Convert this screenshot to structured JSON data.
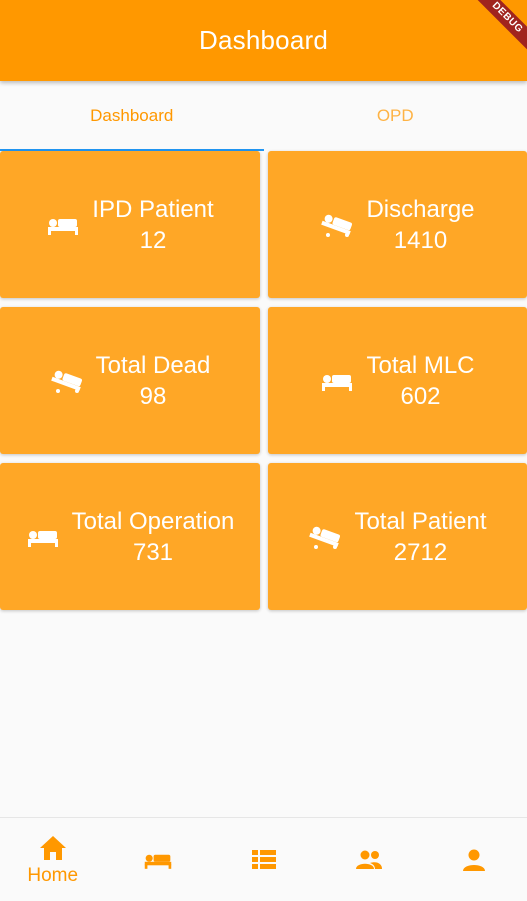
{
  "app": {
    "title": "Dashboard",
    "debug_banner": "DEBUG"
  },
  "tabs": [
    {
      "label": "Dashboard",
      "active": true
    },
    {
      "label": "OPD",
      "active": false
    }
  ],
  "cards": [
    {
      "title": "IPD Patient",
      "value": "12",
      "icon": "hospital-bed-icon"
    },
    {
      "title": "Discharge",
      "value": "1410",
      "icon": "patient-transfer-icon"
    },
    {
      "title": "Total Dead",
      "value": "98",
      "icon": "patient-transfer-icon"
    },
    {
      "title": "Total MLC",
      "value": "602",
      "icon": "hospital-bed-icon"
    },
    {
      "title": "Total Operation",
      "value": "731",
      "icon": "hospital-bed-icon"
    },
    {
      "title": "Total Patient",
      "value": "2712",
      "icon": "patient-transfer-icon"
    }
  ],
  "bottom_nav": {
    "items": [
      {
        "label": "Home",
        "icon": "home-icon",
        "active": true
      },
      {
        "label": "",
        "icon": "hospital-bed-icon"
      },
      {
        "label": "",
        "icon": "list-icon"
      },
      {
        "label": "",
        "icon": "group-icon"
      },
      {
        "label": "",
        "icon": "person-icon"
      }
    ]
  },
  "colors": {
    "primary": "#ff9800",
    "card": "#ffa726",
    "tab_indicator": "#2196f3",
    "background": "#fafafa"
  }
}
